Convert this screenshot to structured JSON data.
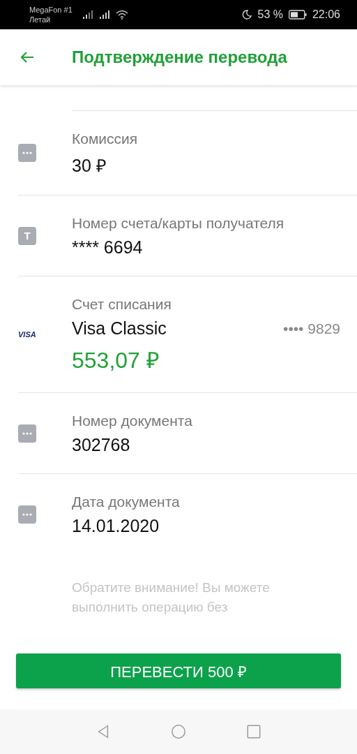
{
  "status_bar": {
    "carrier": "MegaFon #1",
    "carrier_note": "Летай",
    "battery": "53 %",
    "time": "22:06"
  },
  "header": {
    "title": "Подтверждение перевода"
  },
  "rows": [
    {
      "kind": "plain",
      "label": "Комиссия",
      "value": "30 ₽"
    },
    {
      "kind": "lettered",
      "icon_text": "T",
      "label": "Номер счета/карты получателя",
      "value": "**** 6694"
    },
    {
      "kind": "card",
      "icon_text": "VISA",
      "label": "Счет списания",
      "value": "Visa Classic",
      "card_number": "•••• 9829",
      "balance": "553,07 ₽"
    },
    {
      "kind": "plain",
      "label": "Номер документа",
      "value": "302768"
    },
    {
      "kind": "plain",
      "label": "Дата документа",
      "value": "14.01.2020"
    }
  ],
  "note": "Обратите внимание! Вы можете выполнить операцию без",
  "button": {
    "label": "ПЕРЕВЕСТИ 500 ₽"
  }
}
